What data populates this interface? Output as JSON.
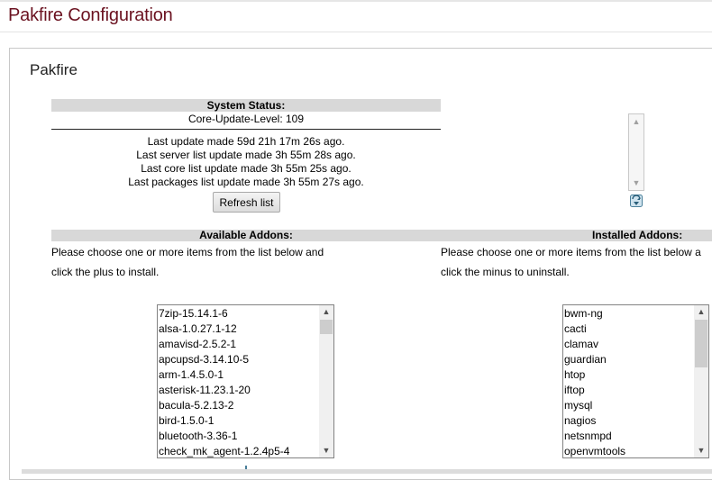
{
  "page_title": "Pakfire Configuration",
  "panel_title": "Pakfire",
  "status": {
    "heading": "System Status:",
    "core_level": "Core-Update-Level: 109",
    "lines": [
      "Last update made 59d 21h 17m 26s ago.",
      "Last server list update made 3h 55m 28s ago.",
      "Last core list update made 3h 55m 25s ago.",
      "Last packages list update made 3h 55m 27s ago."
    ],
    "refresh_label": "Refresh list"
  },
  "available": {
    "heading": "Available Addons:",
    "instruction_1": "Please choose one or more items from the list below and",
    "instruction_2": "click the plus to install.",
    "items": [
      "7zip-15.14.1-6",
      "alsa-1.0.27.1-12",
      "amavisd-2.5.2-1",
      "apcupsd-3.14.10-5",
      "arm-1.4.5.0-1",
      "asterisk-11.23.1-20",
      "bacula-5.2.13-2",
      "bird-1.5.0-1",
      "bluetooth-3.36-1",
      "check_mk_agent-1.2.4p5-4"
    ],
    "scroll_fraction": 0.05
  },
  "installed": {
    "heading": "Installed Addons:",
    "instruction_1": "Please choose one or more items from the list below a",
    "instruction_2": "click the minus to uninstall.",
    "items": [
      "bwm-ng",
      "cacti",
      "clamav",
      "guardian",
      "htop",
      "iftop",
      "mysql",
      "nagios",
      "netsnmpd",
      "openvmtools"
    ],
    "scroll_fraction": 0.42
  },
  "icons": {
    "update": "refresh-update-icon",
    "install": "plus-install-icon",
    "uninstall": "minus-uninstall-icon",
    "scroll_up": "chevron-up-icon",
    "scroll_down": "chevron-down-icon"
  },
  "colors": {
    "title": "#6b1220",
    "header_bar": "#d8d8d8"
  }
}
